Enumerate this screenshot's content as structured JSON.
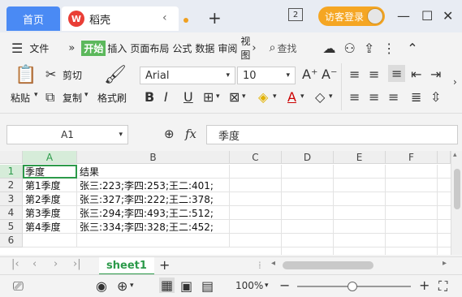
{
  "titlebar": {
    "home_tab": "首页",
    "doc_tab": "稻壳",
    "window_count": "2",
    "login_label": "访客登录"
  },
  "menubar": {
    "menu_icon": "hamburger-icon",
    "file": "文件",
    "items": [
      "开始",
      "插入",
      "页面布局",
      "公式",
      "数据",
      "审阅",
      "视图"
    ],
    "search": "查找"
  },
  "ribbon": {
    "paste": "粘贴",
    "cut": "剪切",
    "copy": "复制",
    "format_painter": "格式刷",
    "font_name": "Arial",
    "font_size": "10"
  },
  "formulabar": {
    "cell_ref": "A1",
    "fx": "fx",
    "content": "季度"
  },
  "sheet": {
    "columns": [
      "A",
      "B",
      "C",
      "D",
      "E",
      "F"
    ],
    "rows": [
      "1",
      "2",
      "3",
      "4",
      "5",
      "6"
    ],
    "cells": [
      [
        "季度",
        "结果"
      ],
      [
        "第1季度",
        "张三:223;李四:253;王二:401;"
      ],
      [
        "第2季度",
        "张三:327;李四:222;王二:378;"
      ],
      [
        "第3季度",
        "张三:294;李四:493;王二:512;"
      ],
      [
        "第4季度",
        "张三:334;李四:328;王二:452;"
      ],
      [
        "",
        ""
      ]
    ]
  },
  "sheettabs": {
    "active": "sheet1"
  },
  "statusbar": {
    "zoom": "100%"
  },
  "colors": {
    "accent_green": "#2c9a4a",
    "home_tab_blue": "#4a8af4",
    "login_orange": "#f5a623"
  }
}
